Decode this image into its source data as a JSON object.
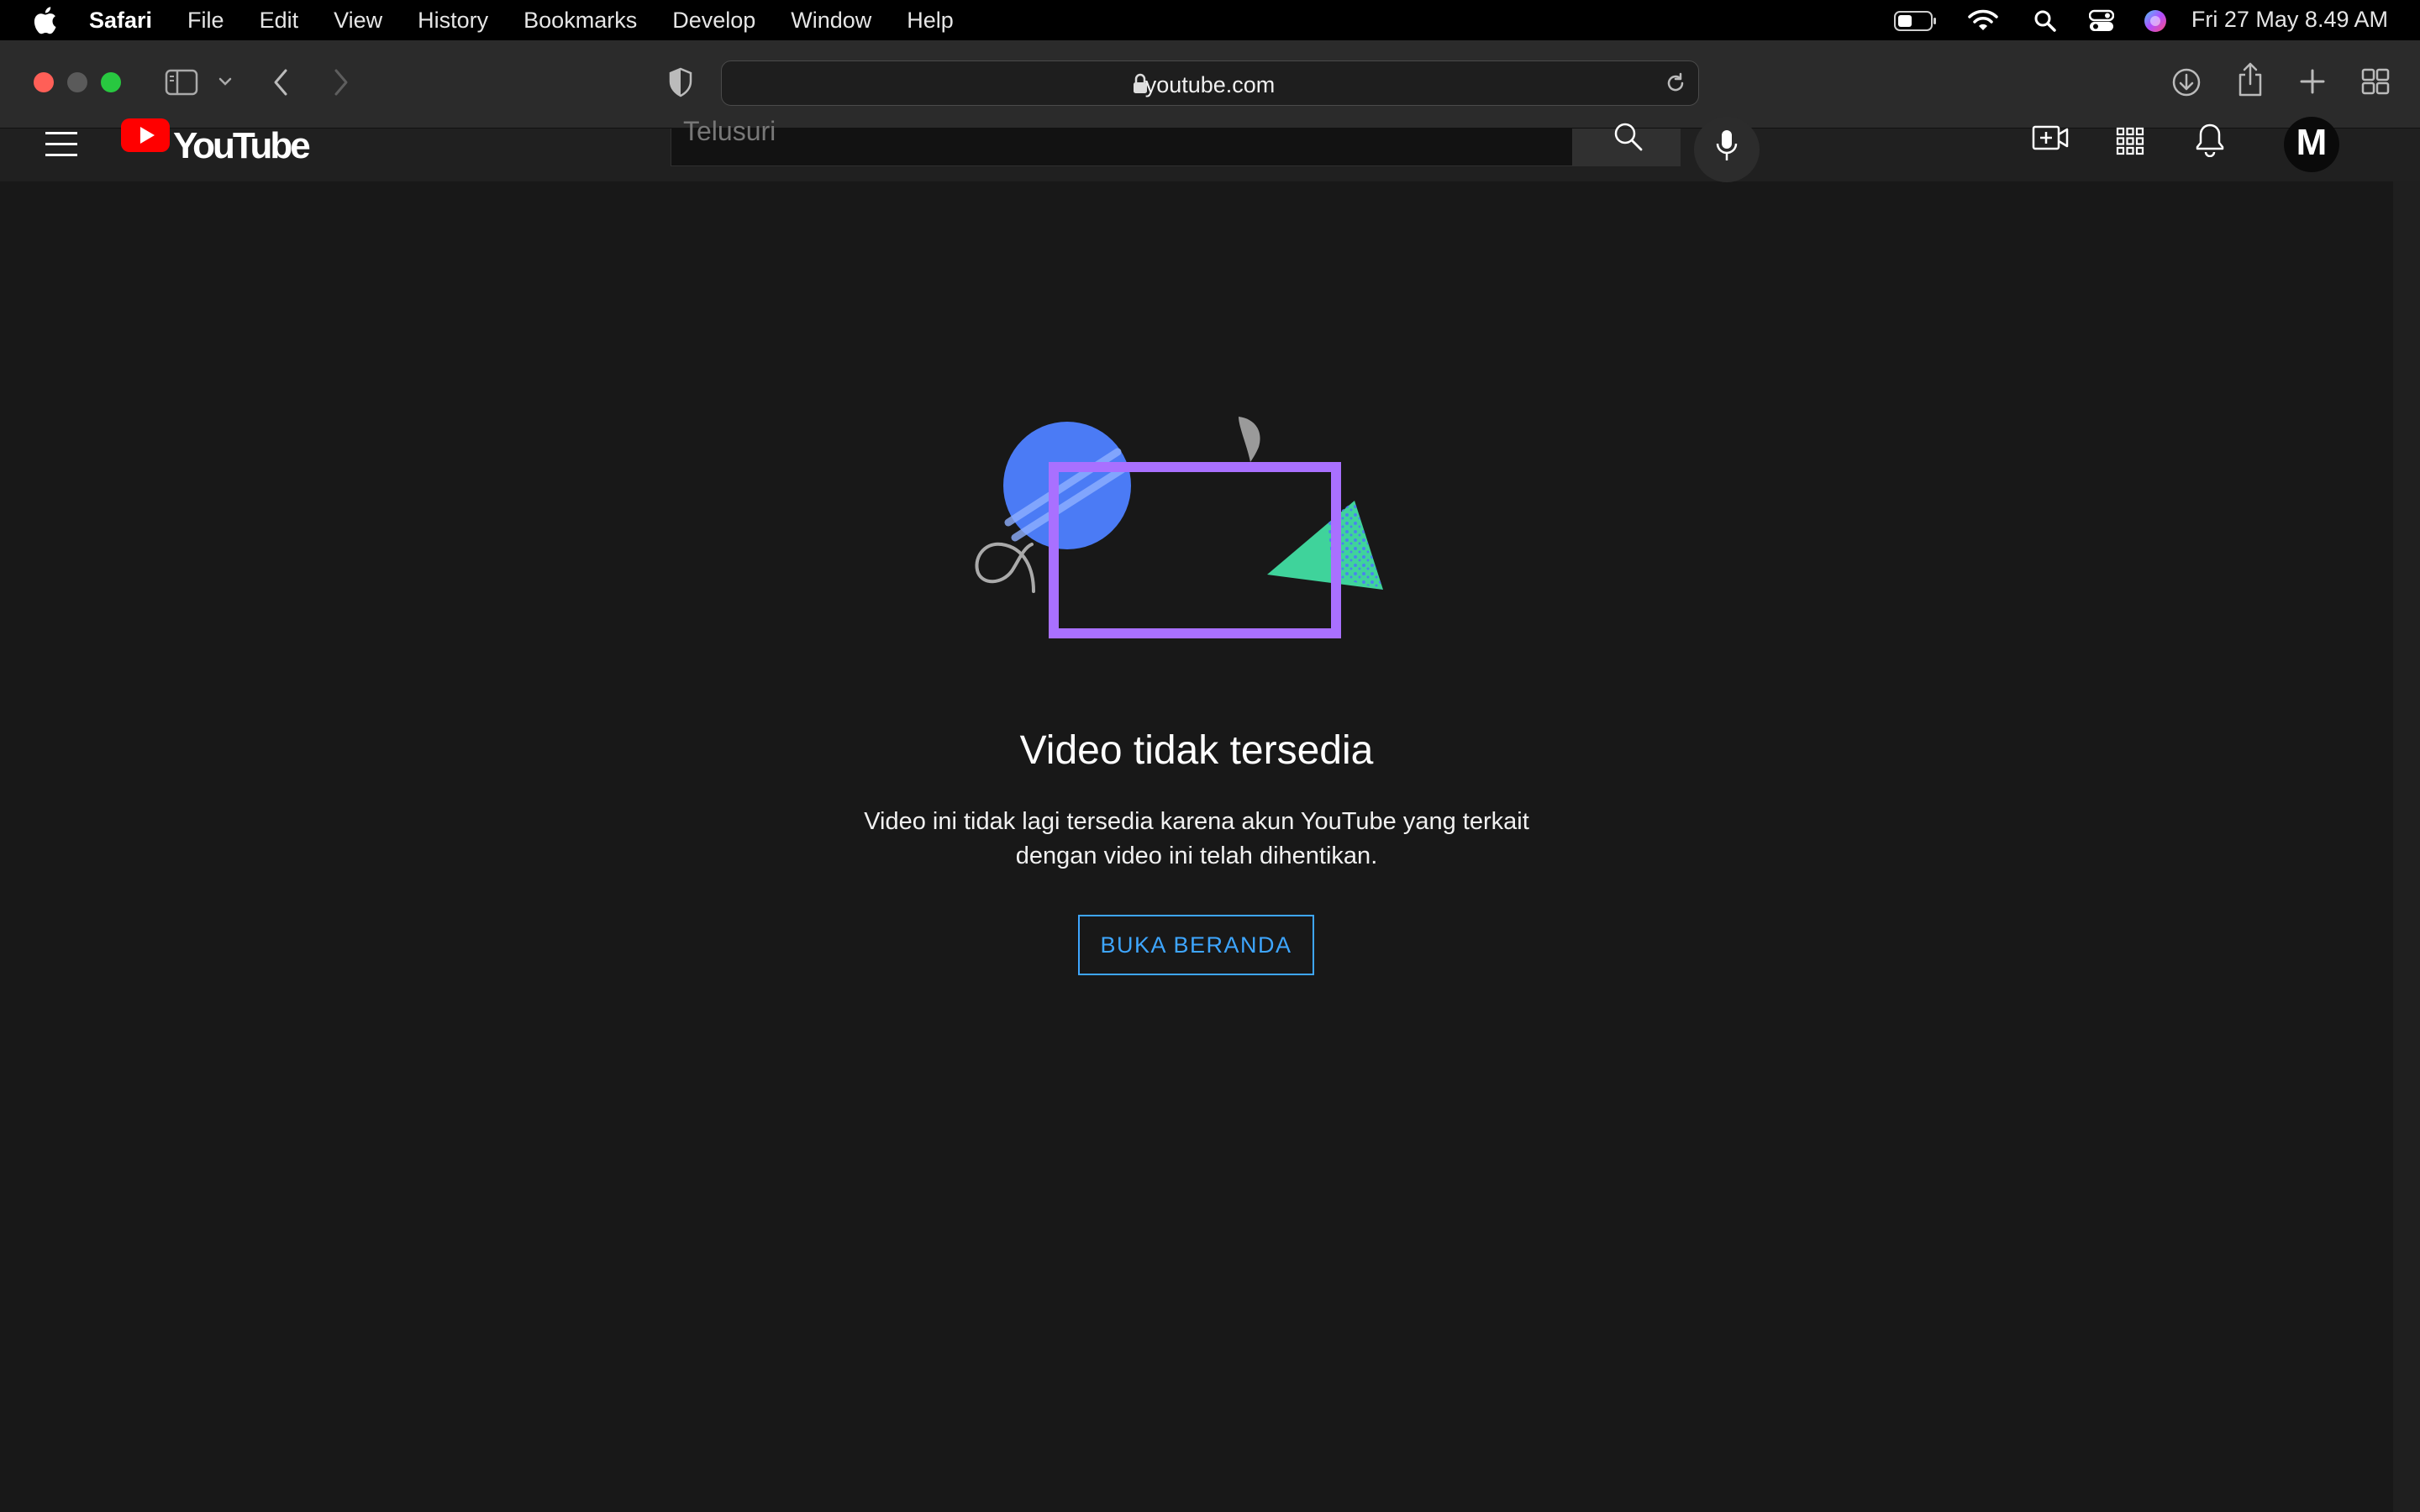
{
  "menubar": {
    "app_name": "Safari",
    "items": [
      "File",
      "Edit",
      "View",
      "History",
      "Bookmarks",
      "Develop",
      "Window",
      "Help"
    ],
    "clock": "Fri 27 May  8.49 AM"
  },
  "toolbar": {
    "url": "youtube.com"
  },
  "youtube": {
    "logo_text": "YouTube",
    "search_placeholder": "Telusuri",
    "avatar_letter": "M"
  },
  "content": {
    "title": "Video tidak tersedia",
    "message_line1": "Video ini tidak lagi tersedia karena akun YouTube yang terkait",
    "message_line2": "dengan video ini telah dihentikan.",
    "home_button": "BUKA BERANDA"
  },
  "colors": {
    "accent_blue": "#3ea6ff",
    "frame_purple": "#a970ff",
    "circle_blue": "#4b7bf5",
    "triangle_green": "#3fd39b",
    "yt_red": "#ff0000"
  },
  "icons": [
    "apple-icon",
    "battery-icon",
    "wifi-icon",
    "spotlight-icon",
    "control-center-icon",
    "siri-icon",
    "sidebar-icon",
    "chevron-down-icon",
    "back-icon",
    "forward-icon",
    "shield-icon",
    "lock-icon",
    "reload-icon",
    "download-icon",
    "share-icon",
    "new-tab-icon",
    "tab-overview-icon",
    "hamburger-icon",
    "youtube-play-icon",
    "search-icon",
    "mic-icon",
    "create-video-icon",
    "apps-icon",
    "bell-icon"
  ]
}
